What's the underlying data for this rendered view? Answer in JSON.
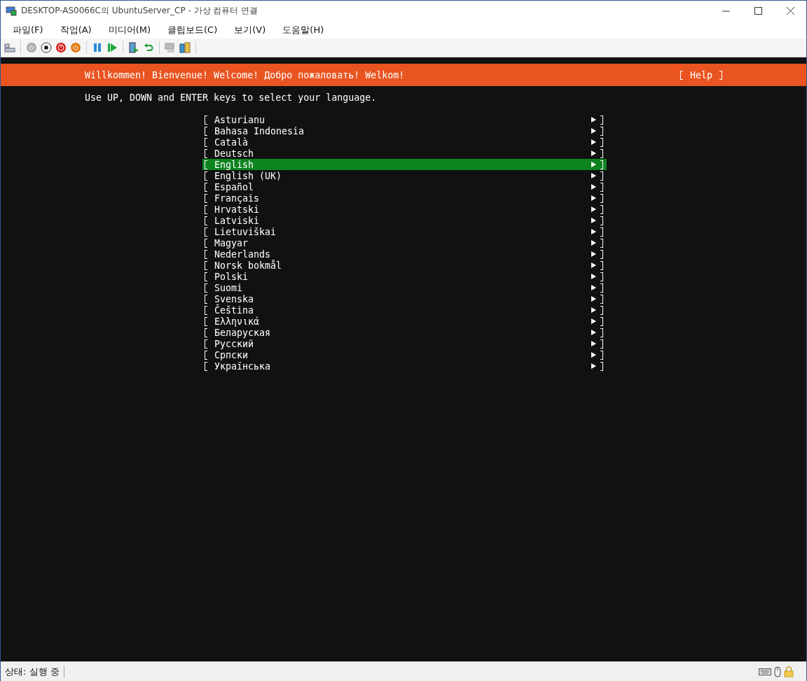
{
  "window": {
    "title": "DESKTOP-AS0066C의 UbuntuServer_CP - 가상 컴퓨터 연결"
  },
  "menu": [
    "파일(F)",
    "작업(A)",
    "미디어(M)",
    "클립보드(C)",
    "보기(V)",
    "도움말(H)"
  ],
  "header": {
    "welcome": "Willkommen! Bienvenue! Welcome! Добро пожаловать! Welkom!",
    "help": "Help"
  },
  "instruction": "Use UP, DOWN and ENTER keys to select your language.",
  "languages": [
    {
      "label": "Asturianu",
      "selected": false
    },
    {
      "label": "Bahasa Indonesia",
      "selected": false
    },
    {
      "label": "Català",
      "selected": false
    },
    {
      "label": "Deutsch",
      "selected": false
    },
    {
      "label": "English",
      "selected": true
    },
    {
      "label": "English (UK)",
      "selected": false
    },
    {
      "label": "Español",
      "selected": false
    },
    {
      "label": "Français",
      "selected": false
    },
    {
      "label": "Hrvatski",
      "selected": false
    },
    {
      "label": "Latviski",
      "selected": false
    },
    {
      "label": "Lietuviškai",
      "selected": false
    },
    {
      "label": "Magyar",
      "selected": false
    },
    {
      "label": "Nederlands",
      "selected": false
    },
    {
      "label": "Norsk bokmål",
      "selected": false
    },
    {
      "label": "Polski",
      "selected": false
    },
    {
      "label": "Suomi",
      "selected": false
    },
    {
      "label": "Svenska",
      "selected": false
    },
    {
      "label": "Čeština",
      "selected": false
    },
    {
      "label": "Ελληνικά",
      "selected": false
    },
    {
      "label": "Беларуская",
      "selected": false
    },
    {
      "label": "Русский",
      "selected": false
    },
    {
      "label": "Српски",
      "selected": false
    },
    {
      "label": "Українська",
      "selected": false
    }
  ],
  "status_bar": {
    "status": "상태: 실행 중"
  }
}
